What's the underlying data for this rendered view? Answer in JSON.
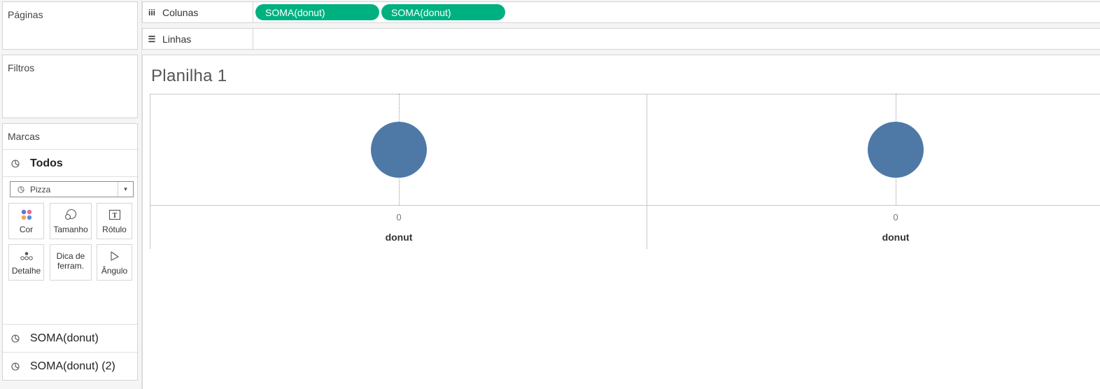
{
  "left": {
    "pages_title": "Páginas",
    "filters_title": "Filtros",
    "marks_title": "Marcas",
    "marks_all_label": "Todos",
    "mark_type": "Pizza",
    "buttons": [
      {
        "label": "Cor",
        "icon": "color-dots-icon"
      },
      {
        "label": "Tamanho",
        "icon": "size-icon"
      },
      {
        "label": "Rótulo",
        "icon": "label-icon"
      },
      {
        "label": "Detalhe",
        "icon": "detail-icon"
      },
      {
        "label": "Dica de ferram.",
        "icon": "tooltip-icon"
      },
      {
        "label": "Ângulo",
        "icon": "angle-icon"
      }
    ],
    "measures": [
      "SOMA(donut)",
      "SOMA(donut) (2)"
    ]
  },
  "shelves": {
    "columns_label": "Colunas",
    "rows_label": "Linhas",
    "column_pills": [
      "SOMA(donut)",
      "SOMA(donut)"
    ]
  },
  "sheet": {
    "title": "Planilha 1"
  },
  "colors": {
    "pill": "#00b180",
    "mark": "#4e79a7"
  },
  "chart_data": {
    "type": "pie",
    "panes": [
      {
        "measure": "SOMA(donut)",
        "x_tick": "0",
        "axis_title": "donut",
        "value": 0
      },
      {
        "measure": "SOMA(donut)",
        "x_tick": "0",
        "axis_title": "donut",
        "value": 0
      }
    ]
  }
}
